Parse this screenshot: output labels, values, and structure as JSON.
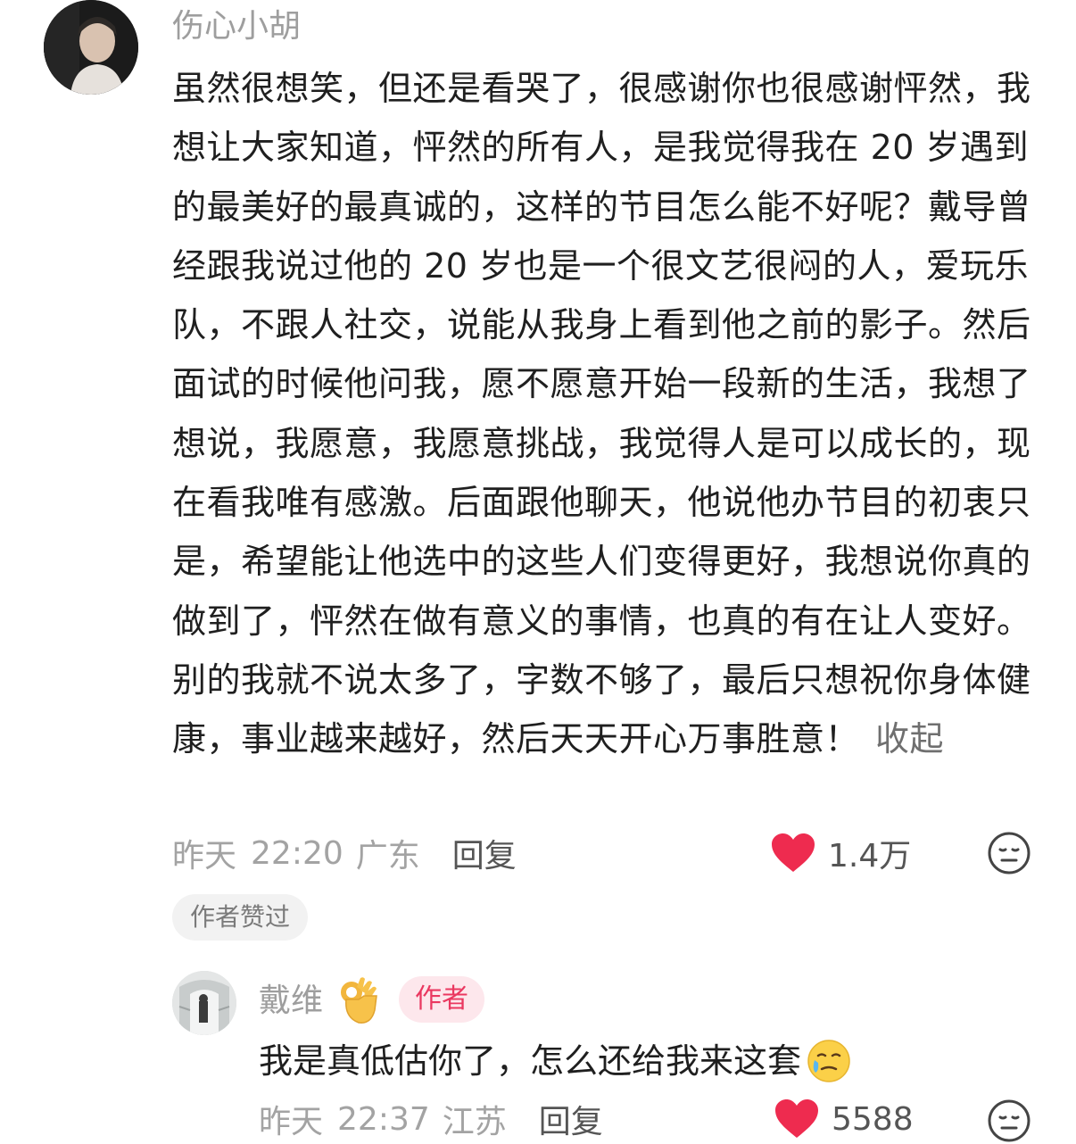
{
  "comment": {
    "username": "伤心小胡",
    "text": "虽然很想笑，但还是看哭了，很感谢你也很感谢怦然，我想让大家知道，怦然的所有人，是我觉得我在 20 岁遇到的最美好的最真诚的，这样的节目怎么能不好呢？戴导曾经跟我说过他的 20 岁也是一个很文艺很闷的人，爱玩乐队，不跟人社交，说能从我身上看到他之前的影子。然后面试的时候他问我，愿不愿意开始一段新的生活，我想了想说，我愿意，我愿意挑战，我觉得人是可以成长的，现在看我唯有感激。后面跟他聊天，他说他办节目的初衷只是，希望能让他选中的这些人们变得更好，我想说你真的做到了，怦然在做有意义的事情，也真的有在让人变好。别的我就不说太多了，字数不够了，最后只想祝你身体健康，事业越来越好，然后天天开心万事胜意！",
    "collapse_label": "收起",
    "date": "昨天",
    "time": "22:20",
    "region": "广东",
    "reply_label": "回复",
    "like_count": "1.4万",
    "author_liked_badge": "作者赞过"
  },
  "reply": {
    "username": "戴维",
    "username_emoji": "ok-hand",
    "author_tag": "作者",
    "text": "我是真低估你了，怎么还给我来这套",
    "text_emoji": "crying-face",
    "date": "昨天",
    "time": "22:37",
    "region": "江苏",
    "reply_label": "回复",
    "like_count": "5588"
  },
  "colors": {
    "like_heart": "#ee2b4f",
    "author_tag_bg": "#fde7ec",
    "author_tag_text": "#ea3860",
    "meta_text": "#a3a3a3"
  }
}
